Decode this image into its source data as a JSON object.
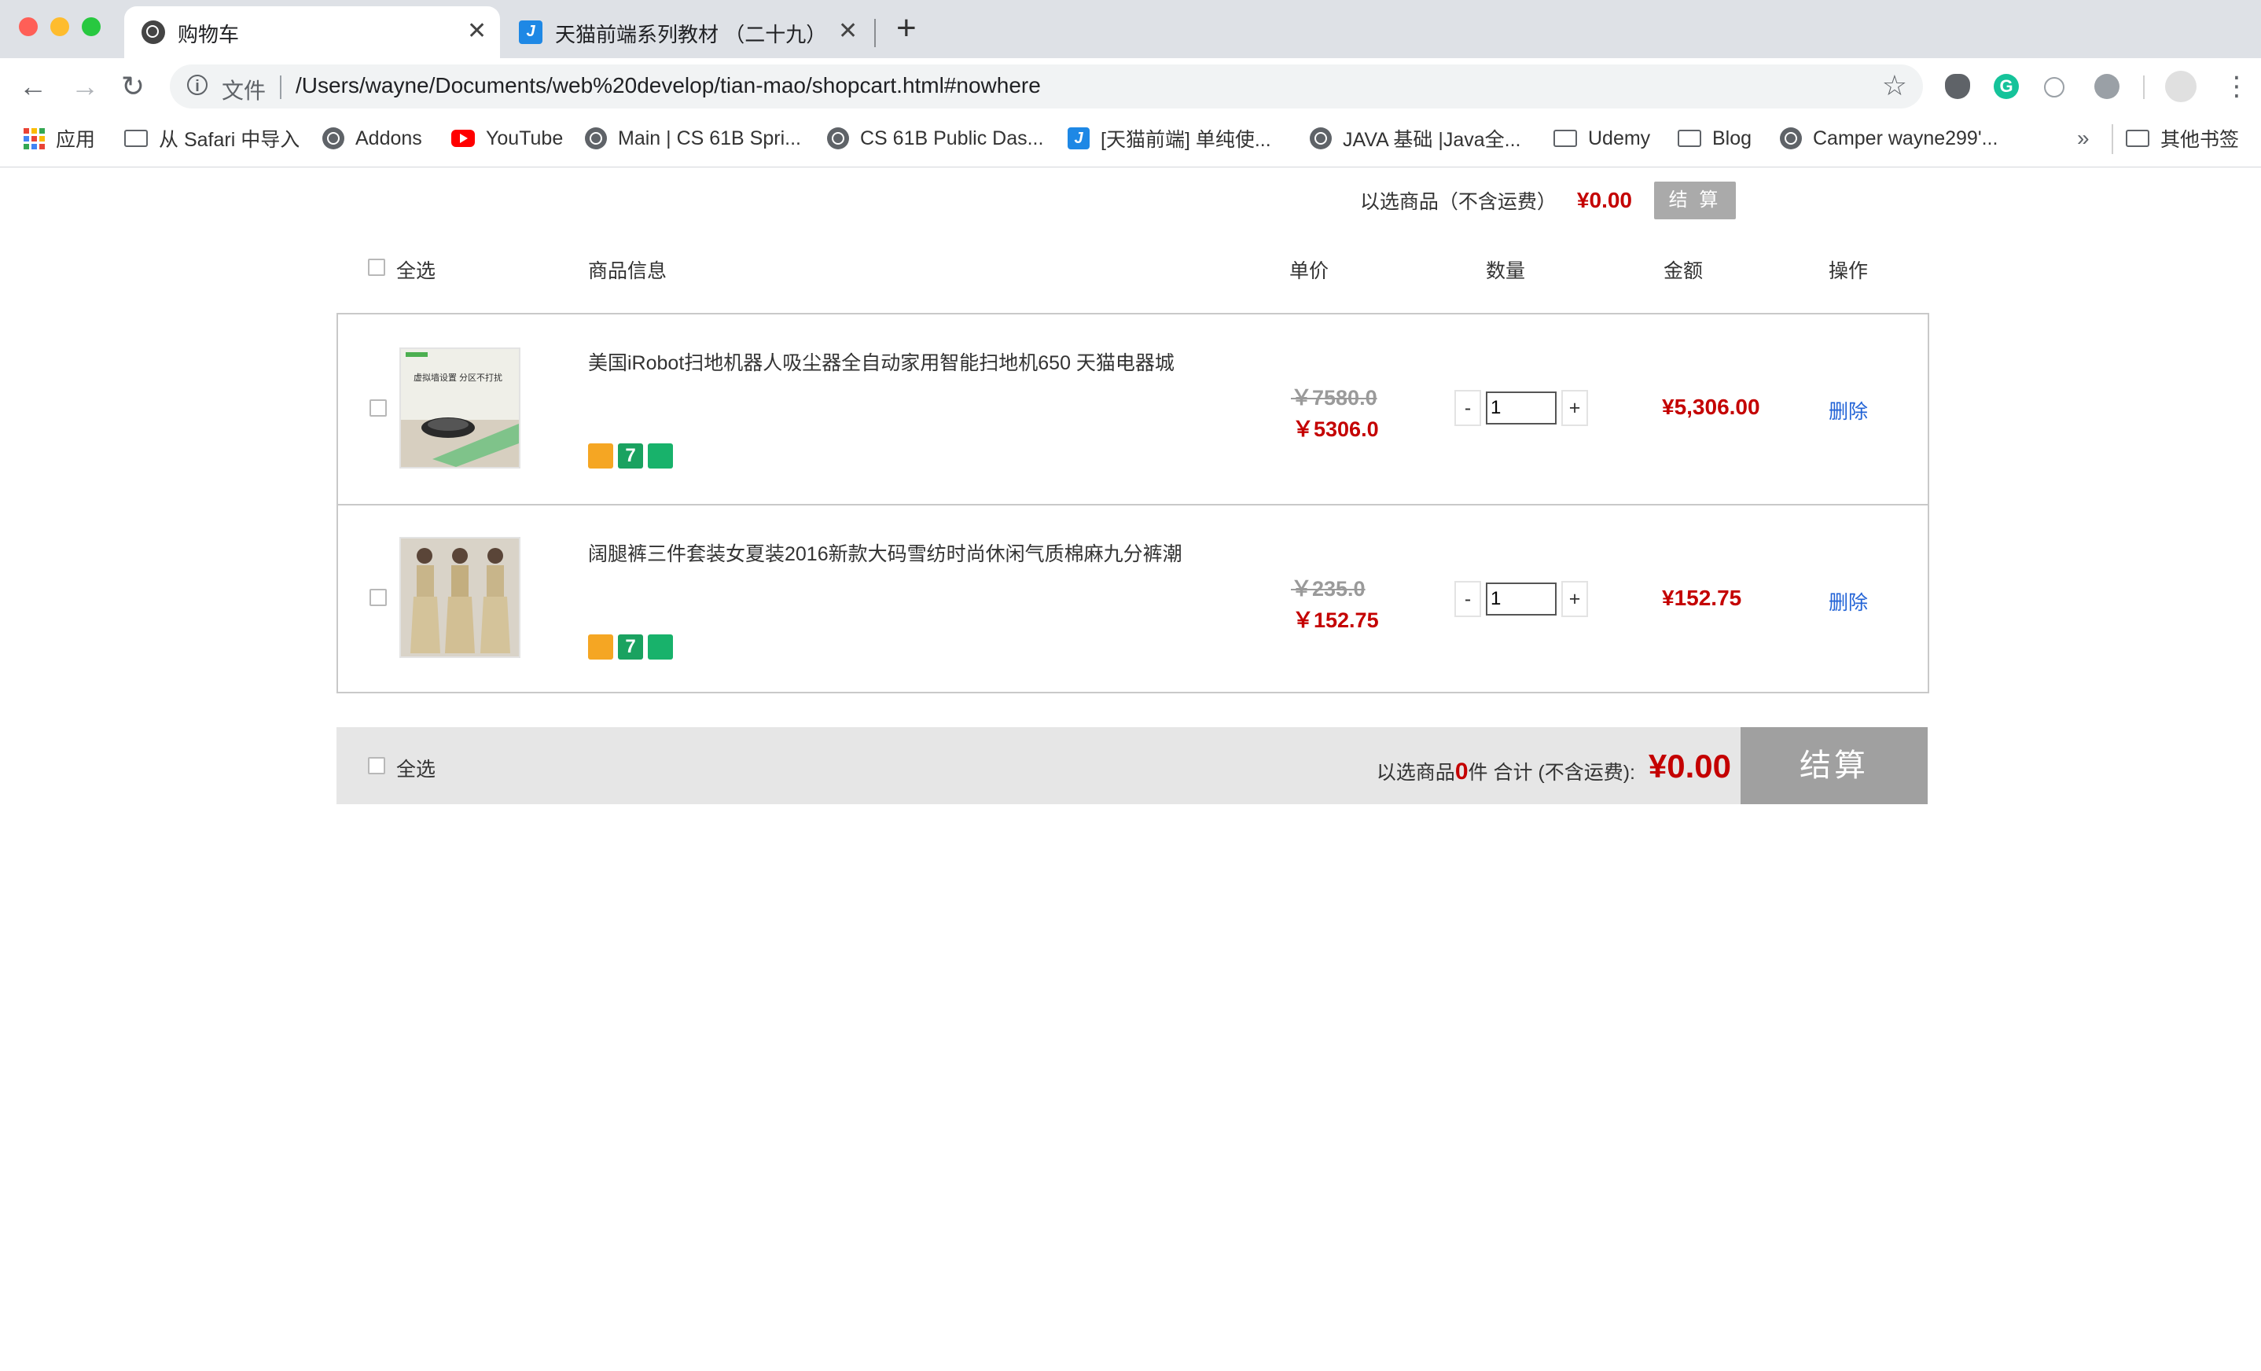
{
  "browser": {
    "tabs": [
      {
        "title": "购物车",
        "active": true
      },
      {
        "title": "天猫前端系列教材 （二十九）- 前",
        "active": false
      }
    ],
    "new_tab": "+",
    "address": {
      "security_label": "文件",
      "url": "/Users/wayne/Documents/web%20develop/tian-mao/shopcart.html#nowhere"
    },
    "bookmarks": [
      {
        "label": "应用",
        "icon": "apps-grid-icon"
      },
      {
        "label": "从 Safari 中导入",
        "icon": "folder-icon"
      },
      {
        "label": "Addons",
        "icon": "globe-icon"
      },
      {
        "label": "YouTube",
        "icon": "youtube-icon"
      },
      {
        "label": "Main | CS 61B Spri...",
        "icon": "globe-icon"
      },
      {
        "label": "CS 61B Public Das...",
        "icon": "globe-icon"
      },
      {
        "label": "[天猫前端] 单纯使...",
        "icon": "jb-icon"
      },
      {
        "label": "JAVA 基础 |Java全...",
        "icon": "globe-icon"
      },
      {
        "label": "Udemy",
        "icon": "folder-icon"
      },
      {
        "label": "Blog",
        "icon": "folder-icon"
      },
      {
        "label": "Camper wayne299'...",
        "icon": "globe-icon"
      }
    ],
    "bookmarks_overflow": "»",
    "other_bookmarks": "其他书签"
  },
  "cart": {
    "top_summary": {
      "label": "以选商品（不含运费）",
      "amount": "¥0.00",
      "button": "结 算"
    },
    "headers": {
      "select_all": "全选",
      "info": "商品信息",
      "unit_price": "单价",
      "quantity": "数量",
      "amount": "金额",
      "action": "操作"
    },
    "items": [
      {
        "name": "美国iRobot扫地机器人吸尘器全自动家用智能扫地机650 天猫电器城",
        "old_price": "￥7580.0",
        "new_price": "￥5306.0",
        "quantity": "1",
        "subtotal": "¥5,306.00",
        "delete": "删除",
        "thumb_caption": "虚拟墙设置 分区不打扰"
      },
      {
        "name": "阔腿裤三件套装女夏装2016新款大码雪纺时尚休闲气质棉麻九分裤潮",
        "old_price": "￥235.0",
        "new_price": "￥152.75",
        "quantity": "1",
        "subtotal": "¥152.75",
        "delete": "删除"
      }
    ],
    "stepper": {
      "minus": "-",
      "plus": "+"
    },
    "footer": {
      "select_all": "全选",
      "prefix": "以选商品",
      "count": "0",
      "suffix": "件 合计 (不含运费):",
      "total": "¥0.00",
      "button": "结算"
    }
  },
  "colors": {
    "price_red": "#c40000",
    "link_blue": "#2263d6",
    "button_gray": "#a0a0a0"
  }
}
